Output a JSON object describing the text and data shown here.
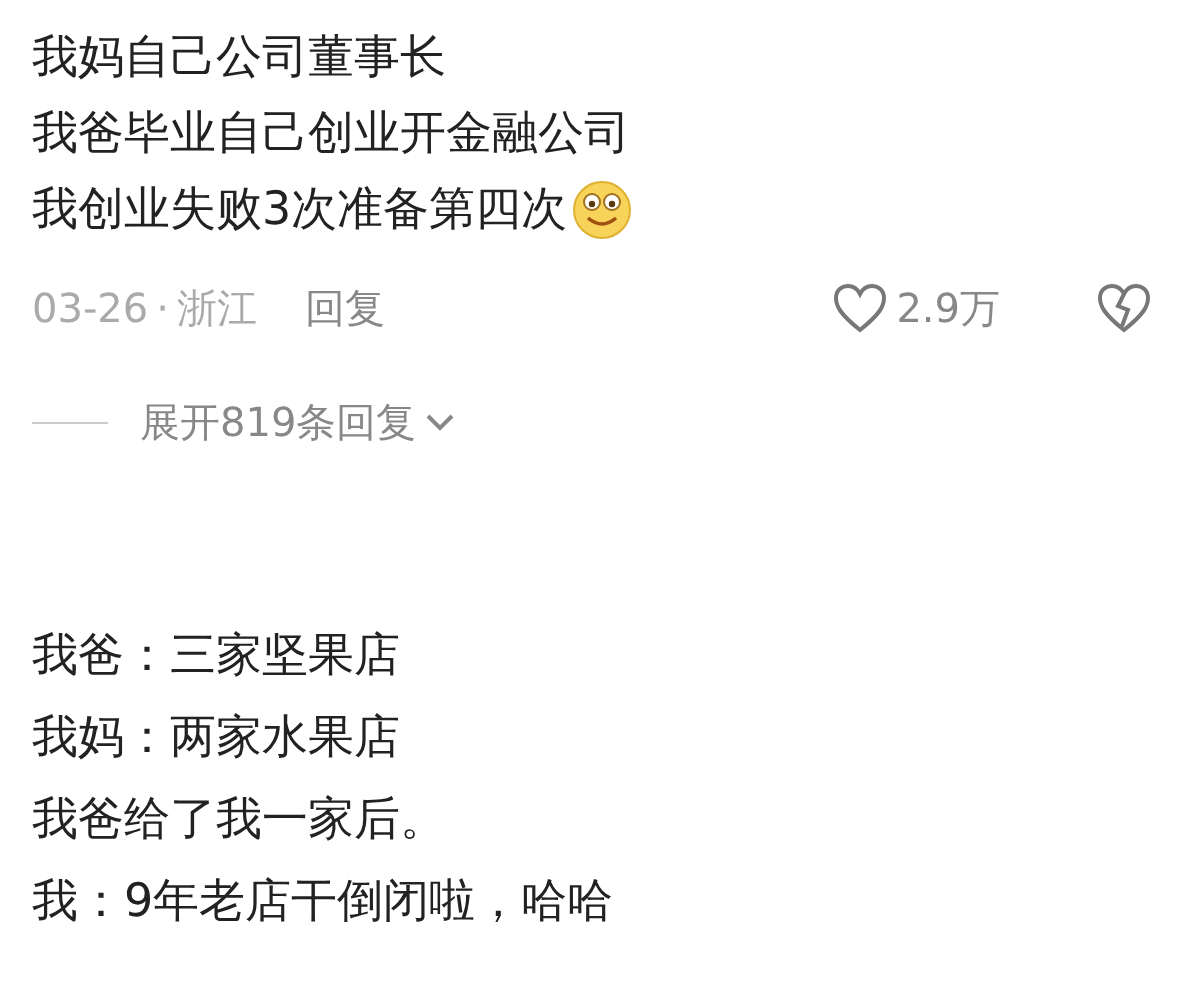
{
  "comment": {
    "lines": [
      "我妈自己公司董事长",
      "我爸毕业自己创业开金融公司",
      "我创业失败3次准备第四次"
    ],
    "date": "03-26",
    "separator": "·",
    "location": "浙江",
    "reply_label": "回复",
    "like_count": "2.9万",
    "expand_label": "展开819条回复"
  },
  "next_comment": {
    "lines": [
      "我爸：三家坚果店",
      "我妈：两家水果店",
      "我爸给了我一家后。",
      "我：9年老店干倒闭啦，哈哈"
    ]
  }
}
